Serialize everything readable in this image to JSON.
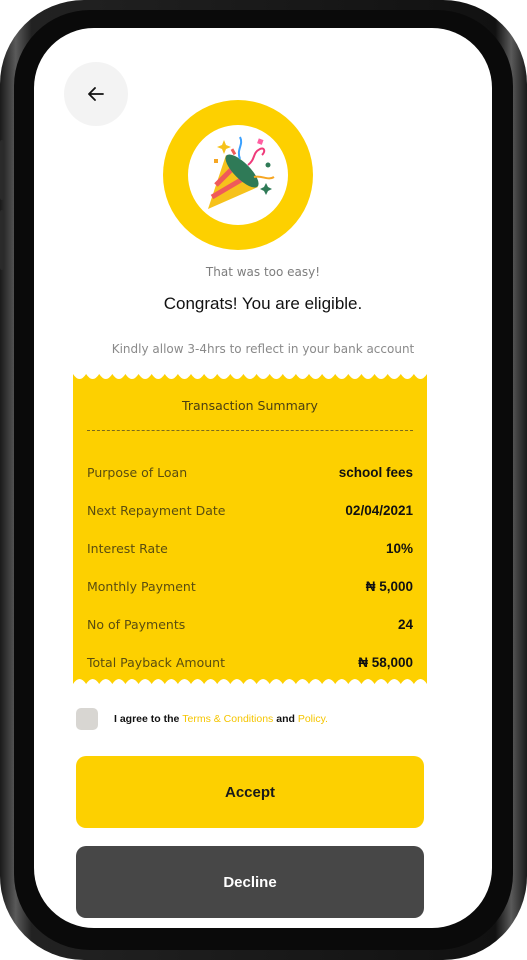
{
  "header": {
    "back_icon": "arrow-left-icon"
  },
  "hero": {
    "icon": "party-popper-icon",
    "ring_color": "#fdd000"
  },
  "subtitle": "That was too easy!",
  "title": "Congrats! You are eligible.",
  "note": "Kindly allow 3-4hrs to reflect in your bank account",
  "summary": {
    "title": "Transaction Summary",
    "rows": [
      {
        "label": "Purpose of Loan",
        "value": "school fees"
      },
      {
        "label": "Next Repayment Date",
        "value": "02/04/2021"
      },
      {
        "label": "Interest Rate",
        "value": "10%"
      },
      {
        "label": "Monthly Payment",
        "value": "₦ 5,000"
      },
      {
        "label": "No of Payments",
        "value": "24"
      },
      {
        "label": "Total Payback Amount",
        "value": "₦ 58,000"
      }
    ]
  },
  "agreement": {
    "prefix": "I agree to the ",
    "terms_link": "Terms & Conditions",
    "middle": " and ",
    "policy_link": "Policy.",
    "checked": false
  },
  "actions": {
    "accept_label": "Accept",
    "decline_label": "Decline"
  },
  "colors": {
    "accent": "#fdd000",
    "decline_bg": "#474747",
    "link": "#f5c500"
  }
}
